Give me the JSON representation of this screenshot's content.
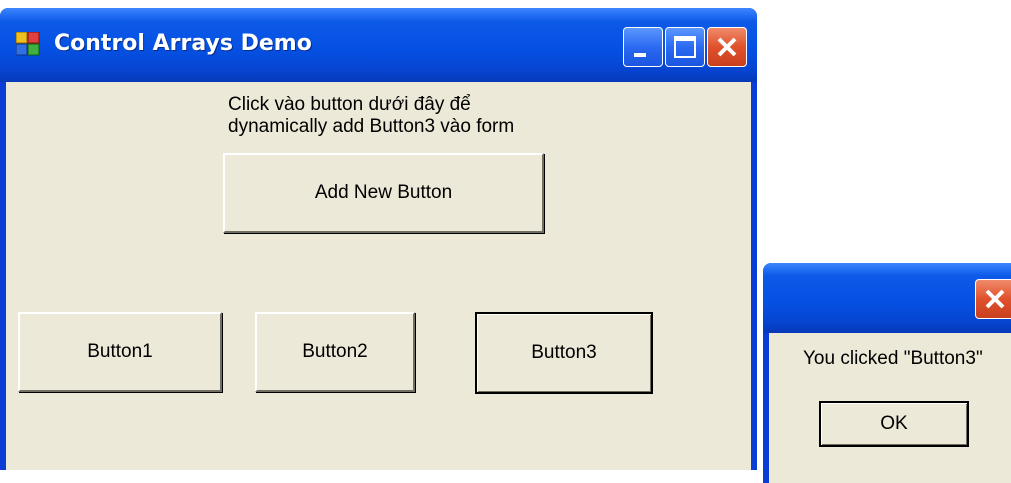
{
  "window": {
    "title": "Control Arrays Demo",
    "label_line1": "Click vào button dưới đây để",
    "label_line2": "dynamically add Button3 vào form",
    "add_button": "Add New Button",
    "buttons": [
      "Button1",
      "Button2",
      "Button3"
    ]
  },
  "message_box": {
    "text": "You clicked \"Button3\"",
    "ok_button": "OK"
  },
  "icons": {
    "app": "app-window-icon",
    "minimize": "minimize-icon",
    "maximize": "maximize-icon",
    "close": "close-icon"
  },
  "colors": {
    "titlebar": "#0551e3",
    "client": "#ece9d8",
    "close_button": "#e0512c"
  }
}
